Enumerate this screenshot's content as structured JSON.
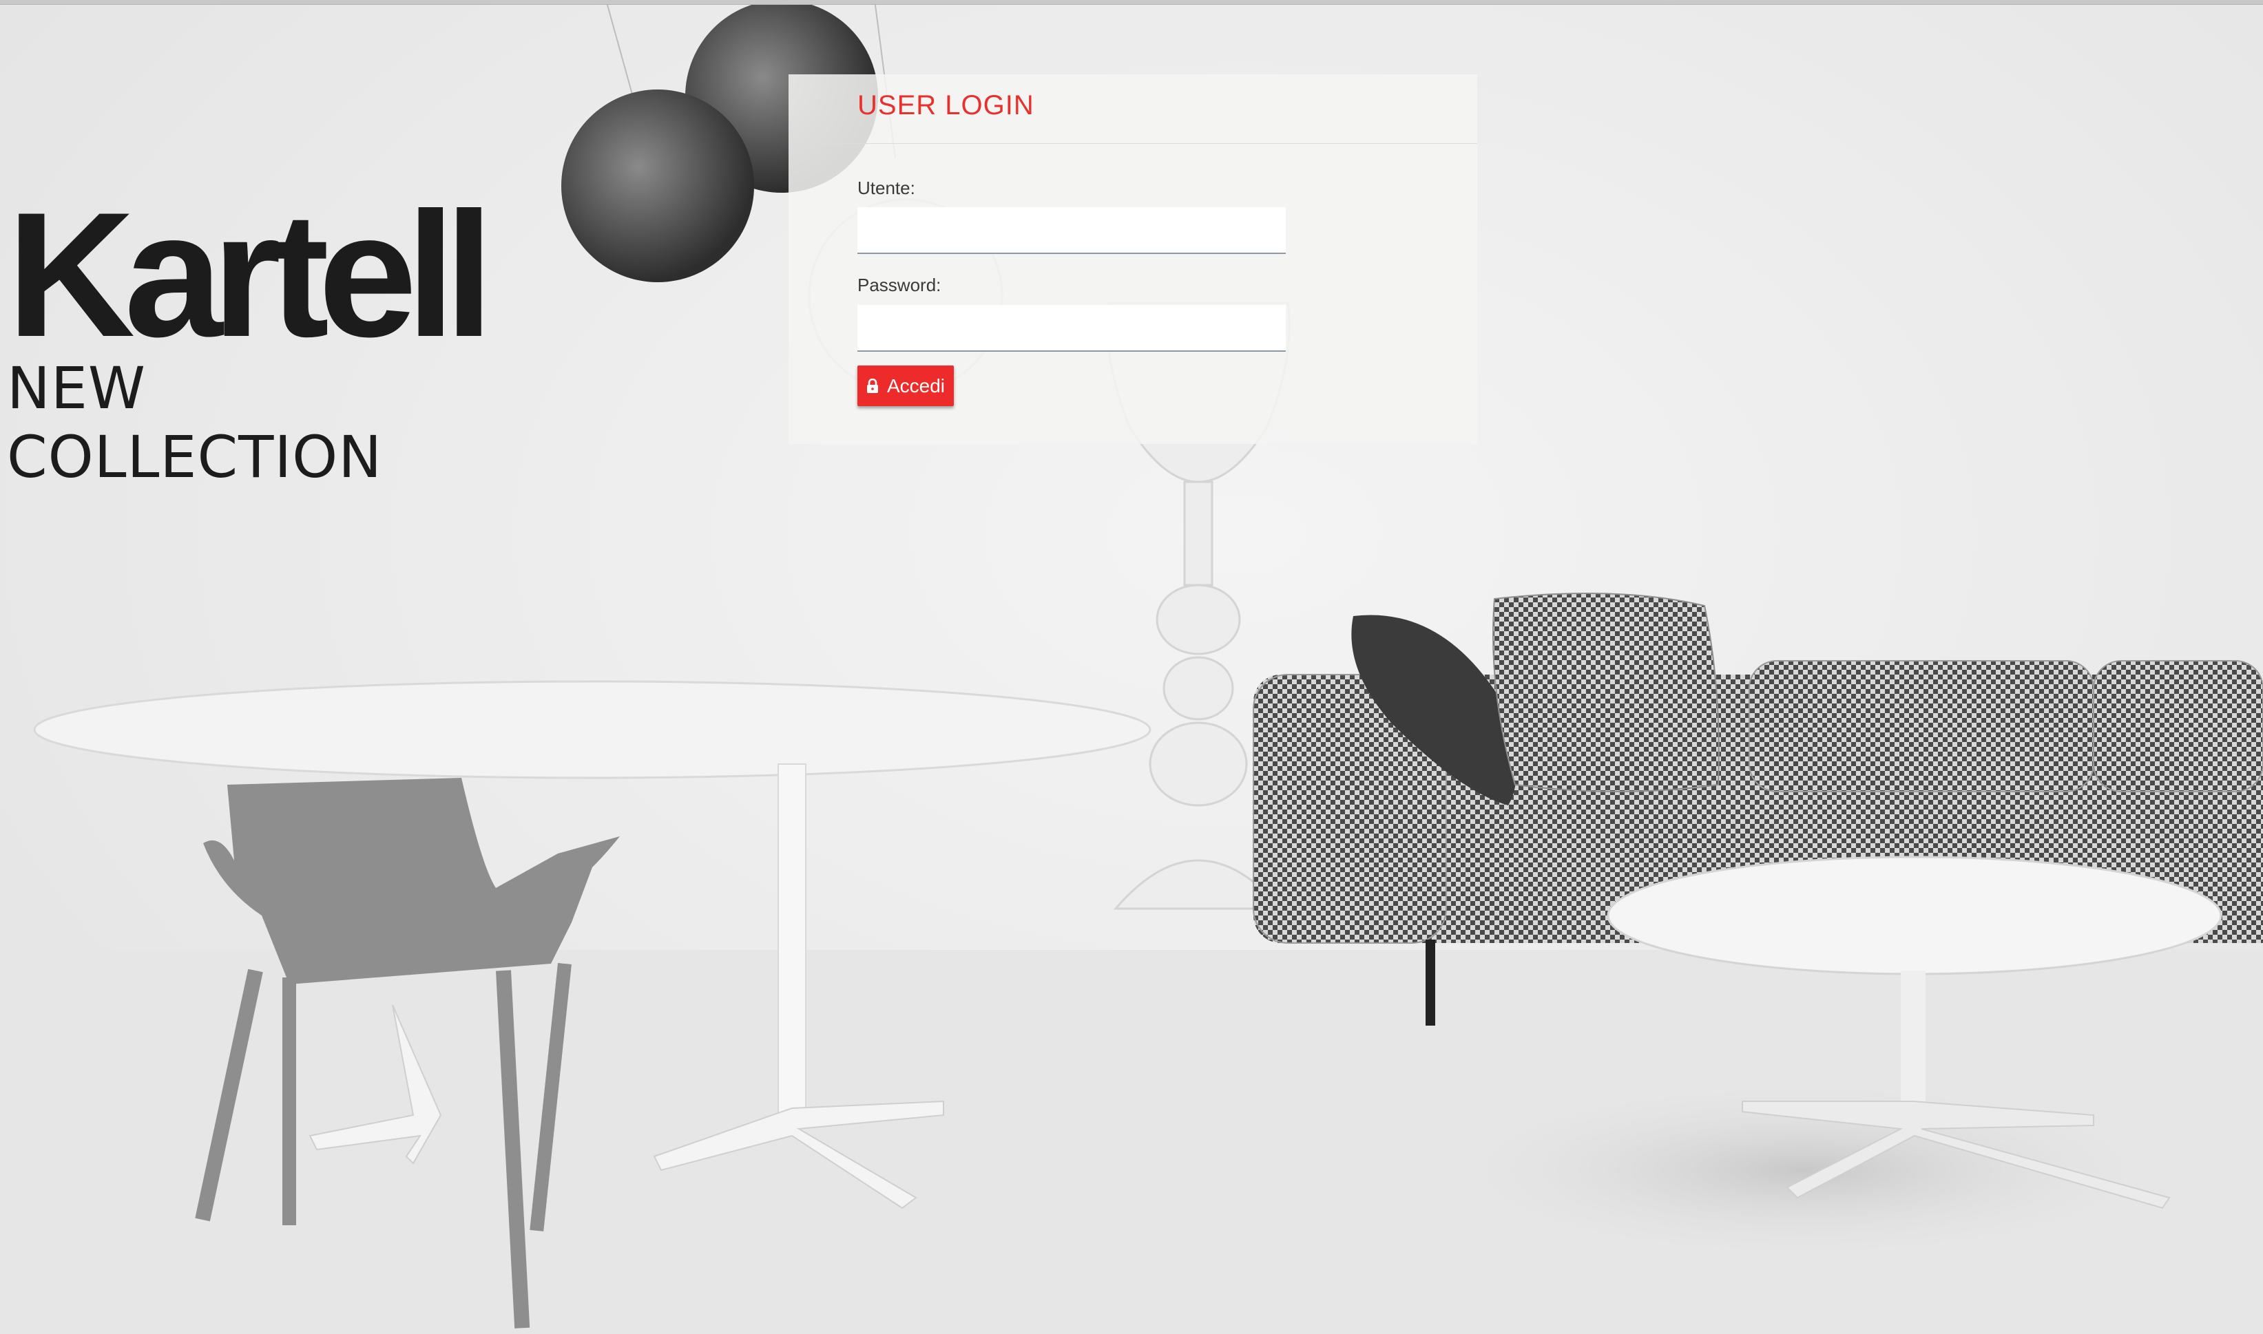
{
  "logo": {
    "brand": "Kartell",
    "tagline": "NEW COLLECTION"
  },
  "login": {
    "title": "USER LOGIN",
    "user_label": "Utente:",
    "user_value": "",
    "password_label": "Password:",
    "password_value": "",
    "submit_label": "Accedi",
    "submit_icon": "lock-icon"
  },
  "colors": {
    "accent": "#ee2b2b",
    "title": "#e8302d"
  }
}
